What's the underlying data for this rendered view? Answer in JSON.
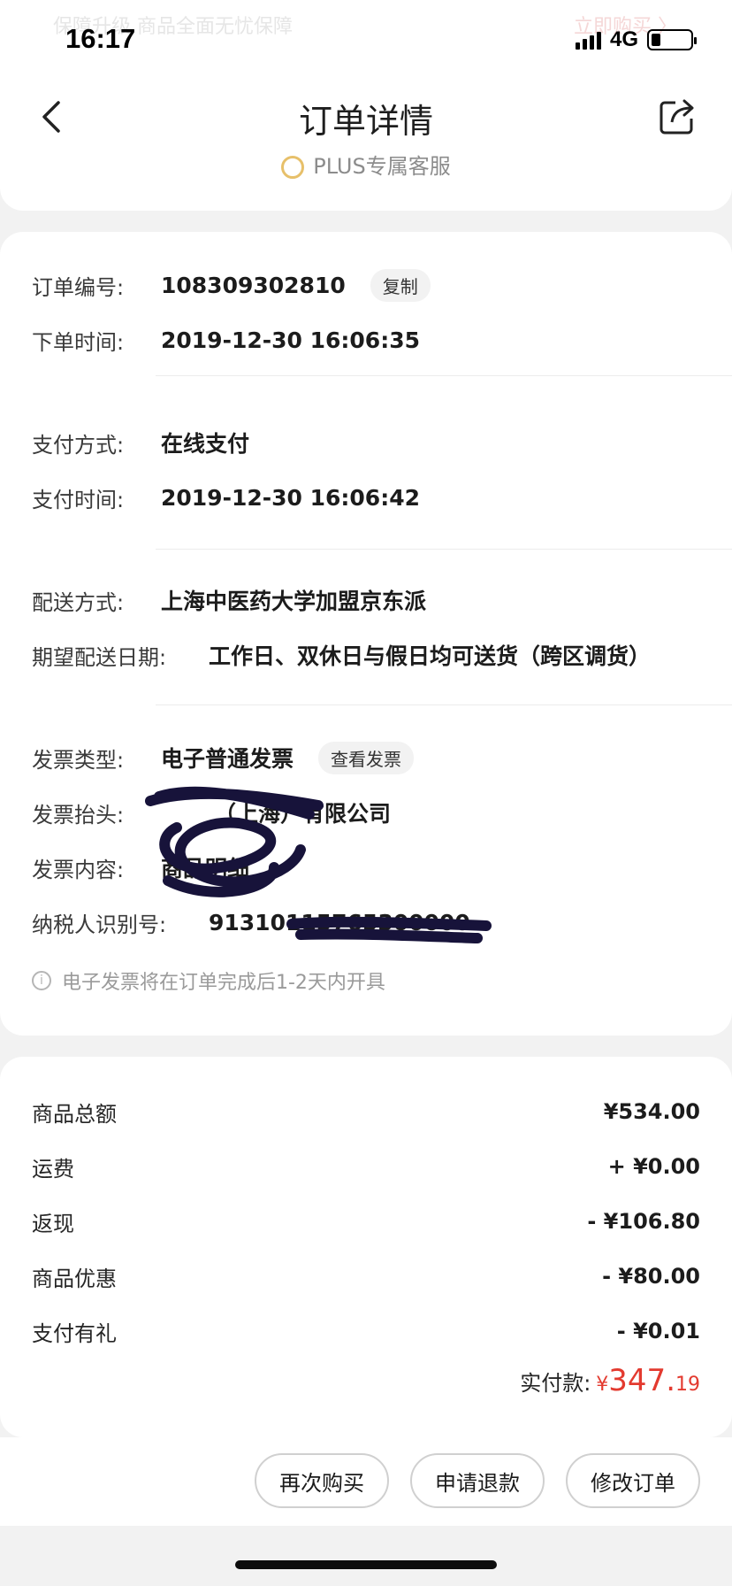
{
  "status_bar": {
    "time": "16:17",
    "network": "4G"
  },
  "ghost_top": {
    "left": "保障升级  商品全面无忧保障",
    "right": "立即购买 〉"
  },
  "header": {
    "title": "订单详情",
    "plus_service": "PLUS专属客服"
  },
  "order_info": {
    "order_no_label": "订单编号:",
    "order_no": "108309302810",
    "copy_label": "复制",
    "order_time_label": "下单时间:",
    "order_time": "2019-12-30 16:06:35"
  },
  "payment": {
    "method_label": "支付方式:",
    "method": "在线支付",
    "time_label": "支付时间:",
    "time": "2019-12-30 16:06:42"
  },
  "delivery": {
    "method_label": "配送方式:",
    "method": "上海中医药大学加盟京东派",
    "date_label": "期望配送日期:",
    "date": "工作日、双休日与假日均可送货（跨区调货）"
  },
  "invoice": {
    "type_label": "发票类型:",
    "type": "电子普通发票",
    "view_label": "查看发票",
    "title_label": "发票抬头:",
    "title": "（上海）有限公司",
    "content_label": "发票内容:",
    "content": "商品明细",
    "tax_label": "纳税人识别号:",
    "tax_id": "91310115765300000",
    "note": "电子发票将在订单完成后1-2天内开具"
  },
  "amounts": {
    "rows": [
      {
        "label": "商品总额",
        "value": "¥534.00"
      },
      {
        "label": "运费",
        "value": "+ ¥0.00"
      },
      {
        "label": "返现",
        "value": "- ¥106.80"
      },
      {
        "label": "商品优惠",
        "value": "- ¥80.00"
      },
      {
        "label": "支付有礼",
        "value": "- ¥0.01"
      }
    ],
    "paid_label": "实付款:",
    "paid_currency": "¥",
    "paid_int": "347.",
    "paid_dec": "19"
  },
  "actions": {
    "rebuy": "再次购买",
    "refund": "申请退款",
    "modify": "修改订单"
  },
  "colors": {
    "accent_red": "#e33a2f",
    "background": "#f2f2f2"
  }
}
